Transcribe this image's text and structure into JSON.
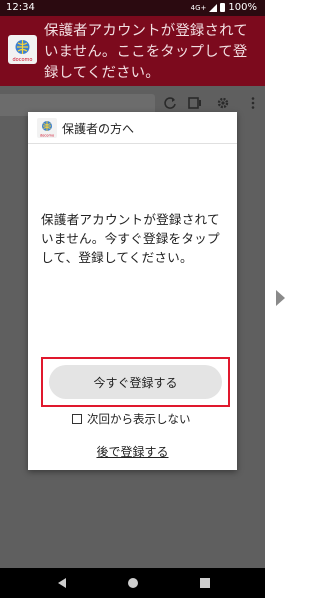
{
  "status_bar": {
    "time": "12:34",
    "network": "4G+",
    "battery": "100%"
  },
  "banner": {
    "logo_text": "docomo",
    "message": "保護者アカウントが登録されていません。ここをタップして登録してください。"
  },
  "dialog": {
    "logo_text": "docomo",
    "title": "保護者の方へ",
    "message": "保護者アカウントが登録されていません。今すぐ登録をタップして、登録してください。",
    "register_now_label": "今すぐ登録する",
    "dont_show_label": "次回から表示しない",
    "dont_show_checked": false,
    "register_later_label": "後で登録する"
  },
  "colors": {
    "banner": "#7c0a1d",
    "highlight": "#e0182d",
    "dim_overlay": "#5f5f5f"
  },
  "icons": {
    "browser": [
      "reload-icon",
      "tabs-icon",
      "settings-icon",
      "more-vert-icon"
    ],
    "nav": [
      "back-icon",
      "home-icon",
      "recents-icon"
    ],
    "page": [
      "next-page-arrow-icon"
    ]
  }
}
